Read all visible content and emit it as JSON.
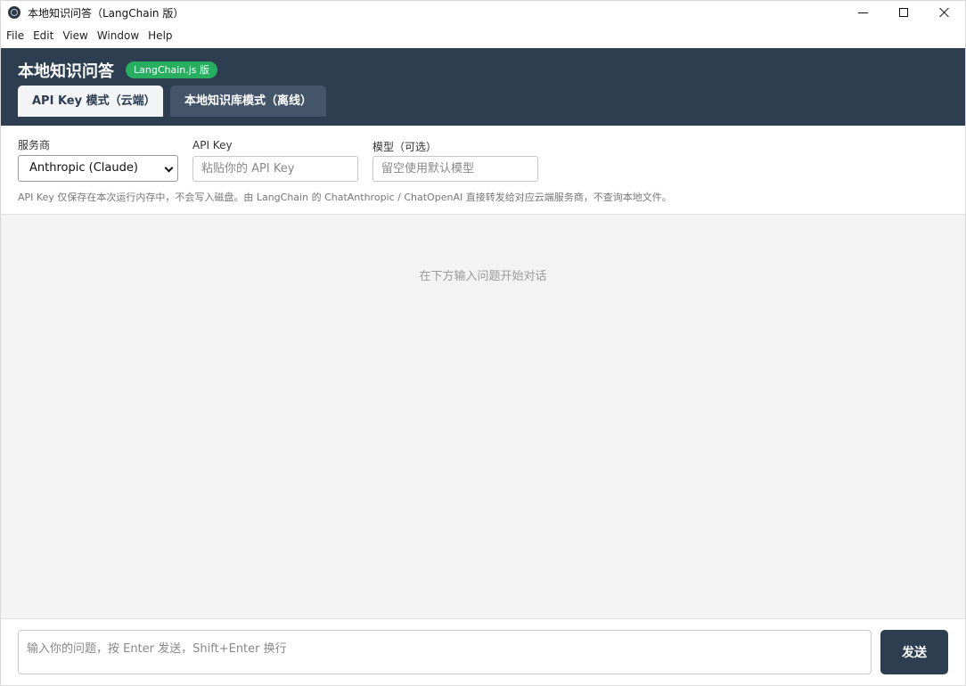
{
  "window": {
    "title": "本地知识问答（LangChain 版）"
  },
  "menu": {
    "items": [
      "File",
      "Edit",
      "View",
      "Window",
      "Help"
    ]
  },
  "header": {
    "title": "本地知识问答",
    "badge": "LangChain.js 版",
    "tabs": [
      {
        "label": "API Key 模式（云端）",
        "active": true
      },
      {
        "label": "本地知识库模式（离线）",
        "active": false
      }
    ]
  },
  "settings": {
    "provider_label": "服务商",
    "provider_value": "Anthropic (Claude)",
    "apikey_label": "API Key",
    "apikey_placeholder": "粘贴你的 API Key",
    "model_label": "模型（可选）",
    "model_placeholder": "留空使用默认模型",
    "hint": "API Key 仅保存在本次运行内存中，不会写入磁盘。由 LangChain 的 ChatAnthropic / ChatOpenAI 直接转发给对应云端服务商，不查询本地文件。"
  },
  "chat": {
    "empty_hint": "在下方输入问题开始对话"
  },
  "composer": {
    "placeholder": "输入你的问题，按 Enter 发送，Shift+Enter 换行",
    "send_label": "发送"
  },
  "colors": {
    "header_bg": "#2c3e50",
    "badge_bg": "#27ae60",
    "send_bg": "#2c3e50"
  }
}
